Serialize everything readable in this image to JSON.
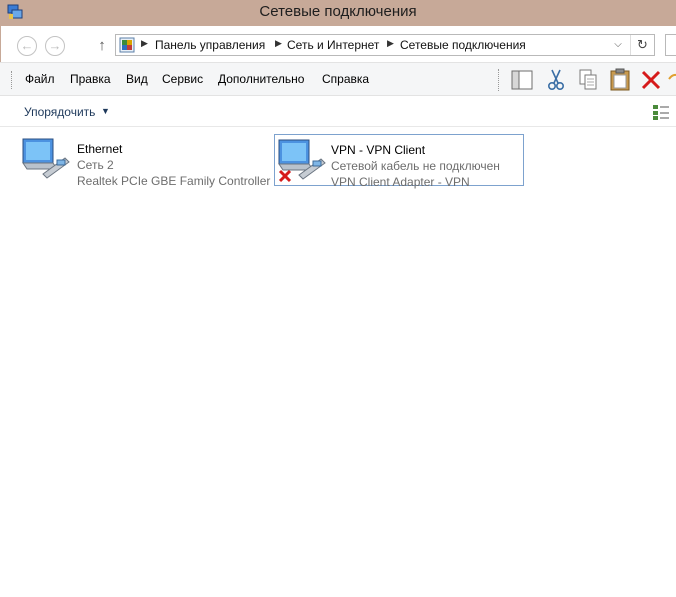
{
  "window": {
    "title": "Сетевые подключения",
    "title_icon": "network-connections-icon"
  },
  "nav": {
    "back_icon": "←",
    "forward_icon": "→",
    "up_icon": "↑"
  },
  "address": {
    "icon": "control-panel-icon",
    "crumbs": [
      "Панель управления",
      "Сеть и Интернет",
      "Сетевые подключения"
    ],
    "separator": "▶",
    "dropdown_icon": "⌵",
    "refresh_icon": "↻"
  },
  "menu": {
    "items": [
      "Файл",
      "Правка",
      "Вид",
      "Сервис",
      "Дополнительно",
      "Справка"
    ]
  },
  "toolbar": {
    "icons": [
      "layout-pane-icon",
      "cut-icon",
      "copy-icon",
      "paste-icon",
      "delete-icon",
      "undo-icon"
    ]
  },
  "command_bar": {
    "organize_label": "Упорядочить",
    "organize_arrow": "▼",
    "view_icon": "change-view-icon"
  },
  "connections": [
    {
      "name": "Ethernet",
      "status": "Сеть  2",
      "adapter": "Realtek PCIe GBE Family Controller",
      "disconnected": false,
      "selected": false
    },
    {
      "name": "VPN - VPN Client",
      "status": "Сетевой кабель не подключен",
      "adapter": "VPN Client Adapter - VPN",
      "disconnected": true,
      "selected": true
    }
  ],
  "colors": {
    "titlebar": "#c7a998",
    "selection_border": "#7da2ce",
    "organize_text": "#1e395b",
    "delete_red": "#d61b1b"
  }
}
